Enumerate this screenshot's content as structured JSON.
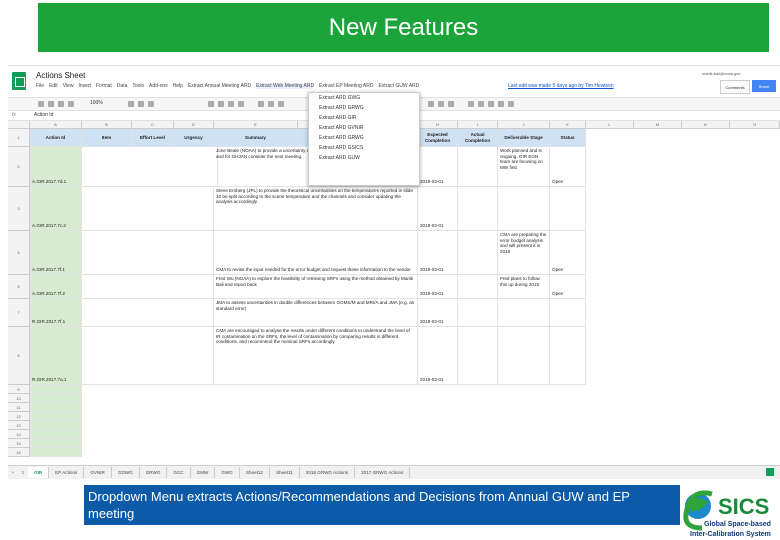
{
  "slide": {
    "title": "New Features",
    "caption": "Dropdown Menu extracts Actions/Recommendations and Decisions from Annual GUW and EP meeting",
    "logo_text": "SICS",
    "logo_subtitle1": "Global Space-based",
    "logo_subtitle2": "Inter-Calibration System"
  },
  "sheet": {
    "doc_title": "Actions Sheet",
    "menus": [
      "File",
      "Edit",
      "View",
      "Insert",
      "Format",
      "Data",
      "Tools",
      "Add-ons",
      "Help"
    ],
    "extract_menus": [
      "Extract Annual Meeting ARD",
      "Extract Web Meeting ARD",
      "Extract EP Meeting ARD",
      "Extract GUW ARD"
    ],
    "last_edit": "Last edit was made 5 days ago by Tim Hewison",
    "account": "manik.bali@noaa.gov",
    "comments_label": "Comments",
    "share_label": "Share",
    "zoom": "100%",
    "fx_label": "fx",
    "formula_value": "Action Id",
    "column_letters": [
      "A",
      "B",
      "C",
      "D",
      "E",
      "F",
      "G",
      "H",
      "I",
      "J",
      "K",
      "L",
      "M",
      "N",
      "O"
    ],
    "headers": [
      "Action Id",
      "Item",
      "Effort Level",
      "Urgency",
      "Summary",
      "",
      "",
      "Expected Completion",
      "Actual Completion",
      "Deliverable Stage",
      "Status"
    ],
    "rows": [
      {
        "num": "2",
        "id": "A.GIR.2017.7d.1",
        "summary": "Jone Beale (NOAA) to provide a uncertainty analysis describing the comparison of manager (TB) and for GHJAN consider the next meeting.",
        "expected": "2018-03-01",
        "stage": "Work planned and is ongoing. GIR EON team are focusing on MW first",
        "status": "Open"
      },
      {
        "num": "3",
        "id": "A.GIR.2017.7c.2",
        "summary": "Steve Ernberg (JPL) to provide the theoretical uncertainties on the temperatures reported in slide 10 be split according to the scene temperature and the channels and consider updating the analysis accordingly",
        "expected": "2018-03-01",
        "stage": "",
        "status": ""
      },
      {
        "num": "4",
        "id": "A.GIR.2017.7f.1",
        "summary": "CMA to revise the input needed for the error budget and request these information to the vendor",
        "expected": "2018-03-01",
        "stage": "CMA are preparing the error budget analysis and will present it in 2018",
        "status": "Open"
      },
      {
        "num": "5",
        "id": "A.GIR.2017.7f.2",
        "summary": "Fred Wu (NOAA) to explore the feasibility of retrieving SRFs using the method obtained by Manik Bali and report back",
        "expected": "2018-03-01",
        "stage": "Fred plans to follow this up during 2018",
        "status": "Open"
      },
      {
        "num": "7",
        "id": "R.GIR.2017.7f.1",
        "summary": "JMA to assess uncertainties in double differences between GOMS/M and MRI/A and JMA (e.g. an standard error)",
        "expected": "2018-03-01",
        "stage": "",
        "status": ""
      },
      {
        "num": "8",
        "id": "R.GIR.2017.7a.1",
        "summary": "CMA are encouraged to analyse the results under different conditions to understand the level of IR contamination on the SRFs, the level of contamination by comparing results in different conditions, and recommend the nominal SRFs accordingly",
        "expected": "2018-03-01",
        "stage": "",
        "status": ""
      }
    ],
    "empty_rows": [
      "9",
      "10",
      "11",
      "12",
      "13",
      "14",
      "15",
      "16"
    ],
    "dropdown_items": [
      "Extract ARD GWG",
      "Extract ARD GRWG",
      "Extract ARD GIR",
      "Extract ARD GVNIR",
      "Extract ARD GRWG",
      "Extract ARD GSICS",
      "Extract ARD GUW"
    ],
    "tabs": [
      "GIR",
      "EP Actions",
      "GVNIR",
      "GDWG",
      "GRWG",
      "GCC",
      "GMW",
      "GWG",
      "Sheet12",
      "Sheet11",
      "2018 GRWG Actions",
      "2017 GRWG Actions"
    ],
    "active_tab": "GIR"
  },
  "colors": {
    "title_bg": "#1aa43a",
    "caption_bg": "#0c5aa8",
    "header_fill": "#cfe2f3",
    "id_column_fill": "#d9ead3",
    "sheets_green": "#0f9d58"
  }
}
